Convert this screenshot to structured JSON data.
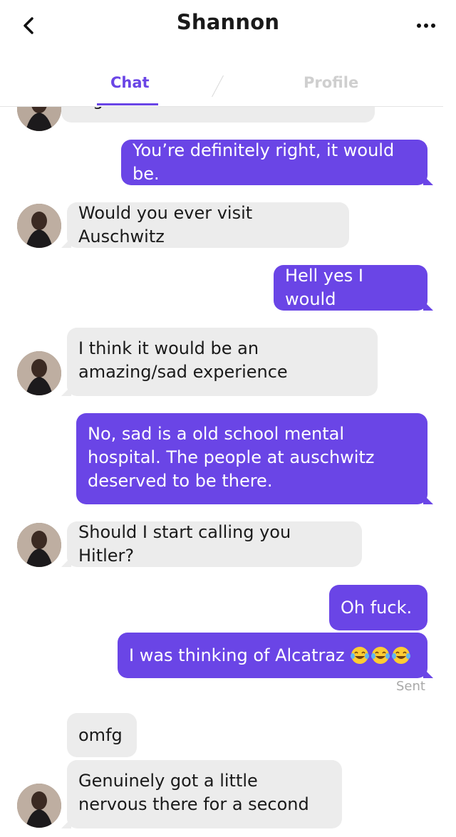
{
  "header": {
    "title": "Shannon",
    "back_icon": "chevron-left-icon",
    "more_icon": "more-dots-icon"
  },
  "tabs": [
    {
      "label": "Chat",
      "active": true
    },
    {
      "label": "Profile",
      "active": false
    }
  ],
  "colors": {
    "accent": "#6a45e6",
    "incoming_bubble": "#ececec",
    "inactive_tab": "#cfcfcf"
  },
  "messages": [
    {
      "from": "them",
      "text": "g"
    },
    {
      "from": "me",
      "text": "You’re definitely right, it would be."
    },
    {
      "from": "them",
      "text": "Would you ever visit Auschwitz"
    },
    {
      "from": "me",
      "text": "Hell yes I would"
    },
    {
      "from": "them",
      "text": "I think it would be an amazing/sad experience"
    },
    {
      "from": "me",
      "text": "No, sad is a old school mental hospital. The people at auschwitz deserved to be there."
    },
    {
      "from": "them",
      "text": "Should I start calling you Hitler?"
    },
    {
      "from": "me",
      "text": "Oh fuck."
    },
    {
      "from": "me",
      "text": "I was thinking of Alcatraz",
      "emoji": "face-with-tears-of-joy-icon ×3"
    },
    {
      "from": "them",
      "text": "omfg"
    },
    {
      "from": "them",
      "text": "Genuinely got a little nervous there for a second"
    }
  ],
  "status": {
    "sent": "Sent"
  }
}
